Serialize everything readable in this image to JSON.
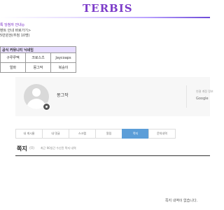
{
  "header": {
    "logo": "TERBIS"
  },
  "notice": {
    "line1": "톡 당첨자 안내◎",
    "line2": "벤트 안내 바로가기>",
    "line3": "5만원권(추첨 10명)"
  },
  "member_table": {
    "title": "공식 커뮤니티 닉네임",
    "rows": [
      [
        "구루루맥",
        "크로스츠",
        "Jaycoaps"
      ],
      [
        "얼파",
        "몽그작",
        "복숭이"
      ]
    ]
  },
  "profile": {
    "nickname": "몽그작",
    "login_label": "연결 계정 정보",
    "login_value": "Google"
  },
  "tabs": [
    {
      "label": "내 게시물",
      "active": false
    },
    {
      "label": "내 댓글",
      "active": false
    },
    {
      "label": "스크랩",
      "active": false
    },
    {
      "label": "알림",
      "active": false
    },
    {
      "label": "쪽지",
      "active": true
    },
    {
      "label": "문의내역",
      "active": false
    }
  ],
  "messages": {
    "title": "쪽지",
    "count": "(0)",
    "description": "최근 90일간 수신된 쪽지 내역",
    "empty_text": "쪽지 내역이 없습니다."
  },
  "colors": {
    "accent": "#7d3cc9",
    "tab_active": "#5c9ed8",
    "table_header": "#e7ddff"
  }
}
